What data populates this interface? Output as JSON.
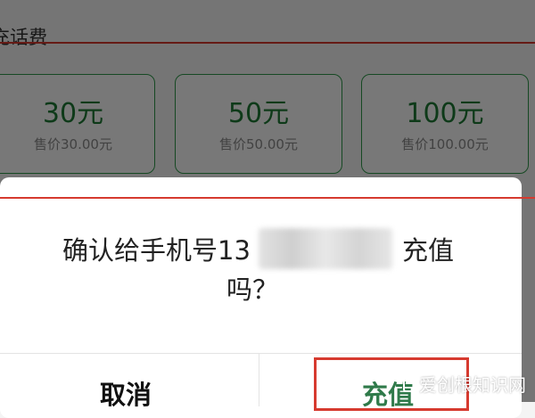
{
  "section": {
    "title": "充话费"
  },
  "cards": [
    {
      "amount": "30元",
      "price": "售价30.00元"
    },
    {
      "amount": "50元",
      "price": "售价50.00元"
    },
    {
      "amount": "100元",
      "price": "售价100.00元"
    }
  ],
  "dialog": {
    "message_prefix": "确认给手机号13",
    "message_suffix": "充值",
    "message_line2": "吗？",
    "cancel_label": "取消",
    "confirm_label": "充值"
  },
  "watermark": {
    "text": "爱创根知识网"
  },
  "colors": {
    "accent_green": "#2f9a4a",
    "annotation_red": "#d63a2f"
  }
}
